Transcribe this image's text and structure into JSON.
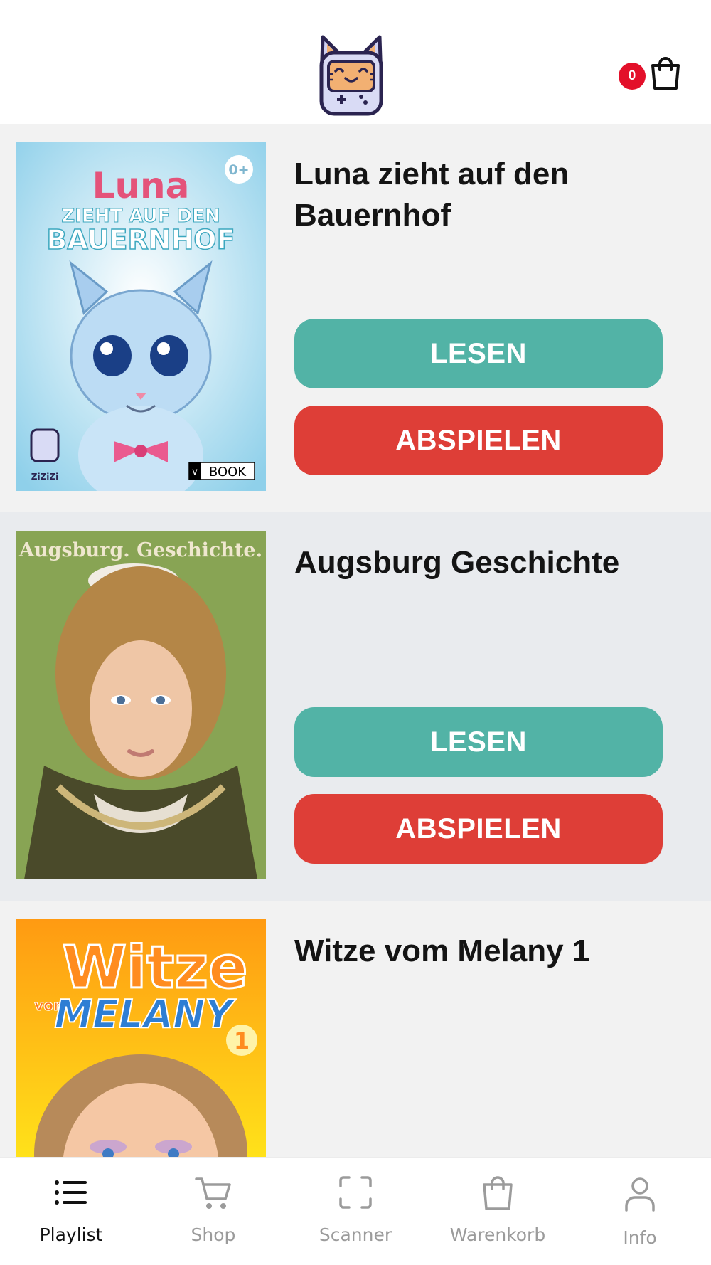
{
  "header": {
    "cart_count": "0"
  },
  "items": [
    {
      "title": "Luna zieht auf den Bauernhof",
      "cover_text": {
        "title": "Luna",
        "subtitle": "ZIEHT AUF DEN",
        "subtitle2": "BAUERNHOF",
        "age": "0+",
        "brand": "ZiZiZi",
        "format": "BOOK"
      },
      "read_label": "LESEN",
      "play_label": "ABSPIELEN"
    },
    {
      "title": "Augsburg Geschichte",
      "cover_text": {
        "title": "Augsburg. Geschichte."
      },
      "read_label": "LESEN",
      "play_label": "ABSPIELEN"
    },
    {
      "title": "Witze vom Melany 1",
      "cover_text": {
        "title": "Witze",
        "vom": "vom",
        "name": "MELANY",
        "number": "1"
      }
    }
  ],
  "nav": [
    {
      "label": "Playlist",
      "icon": "list-icon",
      "active": true
    },
    {
      "label": "Shop",
      "icon": "shopping-cart-icon",
      "active": false
    },
    {
      "label": "Scanner",
      "icon": "scan-frame-icon",
      "active": false
    },
    {
      "label": "Warenkorb",
      "icon": "shopping-bag-icon",
      "active": false
    },
    {
      "label": "Info",
      "icon": "user-icon",
      "active": false
    }
  ],
  "colors": {
    "read_button": "#52b3a6",
    "play_button": "#de3e37",
    "badge": "#e3102a",
    "item_bg_light": "#f2f2f2",
    "item_bg_alt": "#e9ebee"
  }
}
